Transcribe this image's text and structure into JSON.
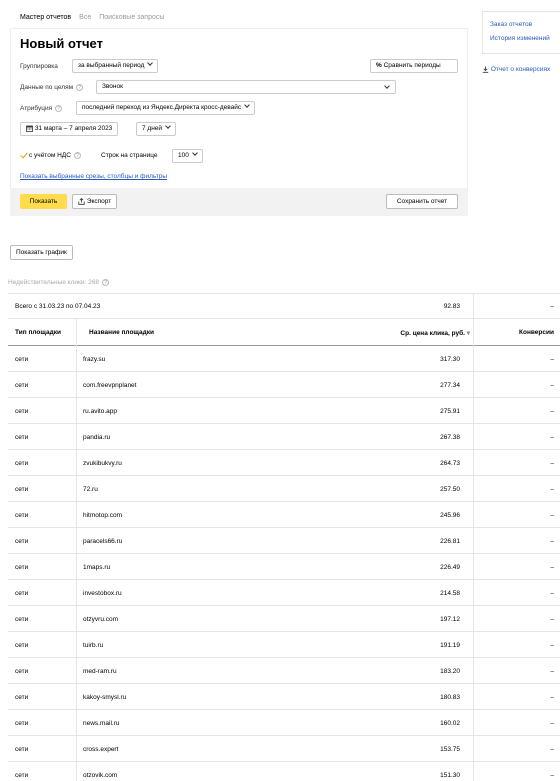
{
  "tabs": [
    {
      "label": "Мастер отчетов"
    },
    {
      "label": "Все"
    },
    {
      "label": "Поисковые запросы"
    }
  ],
  "report": {
    "title": "Новый отчет",
    "grouping": {
      "label": "Группировка",
      "value": "за выбранный период"
    },
    "compare_button": "Сравнить периоды",
    "goals": {
      "label": "Данные по целям",
      "value": "Звонок"
    },
    "attribution": {
      "label": "Атрибуция",
      "value": "последний переход из Яндекс.Директа кросс-девайс"
    },
    "date_range": "31 марта – 7 апреля 2023",
    "period": "7 дней",
    "vat": {
      "label": "с учётом НДС"
    },
    "rows_per_page": {
      "label": "Строк на странице",
      "value": "100"
    },
    "show_filters_link": "Показать выбранные срезы, столбцы и фильтры",
    "show_button": "Показать",
    "export_button": "Экспорт",
    "save_button": "Сохранить отчет"
  },
  "sidebar": {
    "links": [
      "Заказ отчетов",
      "История изменений"
    ],
    "conversions_link": "Отчет о конверсиях"
  },
  "show_chart_button": "Показать график",
  "invalid_clicks": "Недействительные клики: 268",
  "table": {
    "total": {
      "label": "Всего с 31.03.23 по 07.04.23",
      "value": "92.83",
      "conv": "–"
    },
    "headers": [
      "Тип площадки",
      "Название площадки",
      "Ср. цена клика, руб.",
      "Конверсии"
    ],
    "rows": [
      {
        "type": "сети",
        "name": "frazy.su",
        "cpc": "317.30",
        "conv": "–"
      },
      {
        "type": "сети",
        "name": "com.freevpnplanet",
        "cpc": "277.34",
        "conv": "–"
      },
      {
        "type": "сети",
        "name": "ru.avito.app",
        "cpc": "275.91",
        "conv": "–"
      },
      {
        "type": "сети",
        "name": "pandia.ru",
        "cpc": "267.38",
        "conv": "–"
      },
      {
        "type": "сети",
        "name": "zvukibukvy.ru",
        "cpc": "264.73",
        "conv": "–"
      },
      {
        "type": "сети",
        "name": "72.ru",
        "cpc": "257.50",
        "conv": "–"
      },
      {
        "type": "сети",
        "name": "hitmotop.com",
        "cpc": "245.96",
        "conv": "–"
      },
      {
        "type": "сети",
        "name": "paracels66.ru",
        "cpc": "226.81",
        "conv": "–"
      },
      {
        "type": "сети",
        "name": "1maps.ru",
        "cpc": "226.49",
        "conv": "–"
      },
      {
        "type": "сети",
        "name": "investobox.ru",
        "cpc": "214.58",
        "conv": "–"
      },
      {
        "type": "сети",
        "name": "otzyvru.com",
        "cpc": "197.12",
        "conv": "–"
      },
      {
        "type": "сети",
        "name": "tuirb.ru",
        "cpc": "191.19",
        "conv": "–"
      },
      {
        "type": "сети",
        "name": "med-ram.ru",
        "cpc": "183.20",
        "conv": "–"
      },
      {
        "type": "сети",
        "name": "kakoy-smysl.ru",
        "cpc": "180.83",
        "conv": "–"
      },
      {
        "type": "сети",
        "name": "news.mail.ru",
        "cpc": "160.02",
        "conv": "–"
      },
      {
        "type": "сети",
        "name": "cross.expert",
        "cpc": "153.75",
        "conv": "–"
      },
      {
        "type": "сети",
        "name": "otzovik.com",
        "cpc": "151.30",
        "conv": "–"
      }
    ]
  },
  "colors": {
    "accent": "#ffdb4d",
    "link": "#2a5ab8",
    "check": "#e4a600"
  }
}
